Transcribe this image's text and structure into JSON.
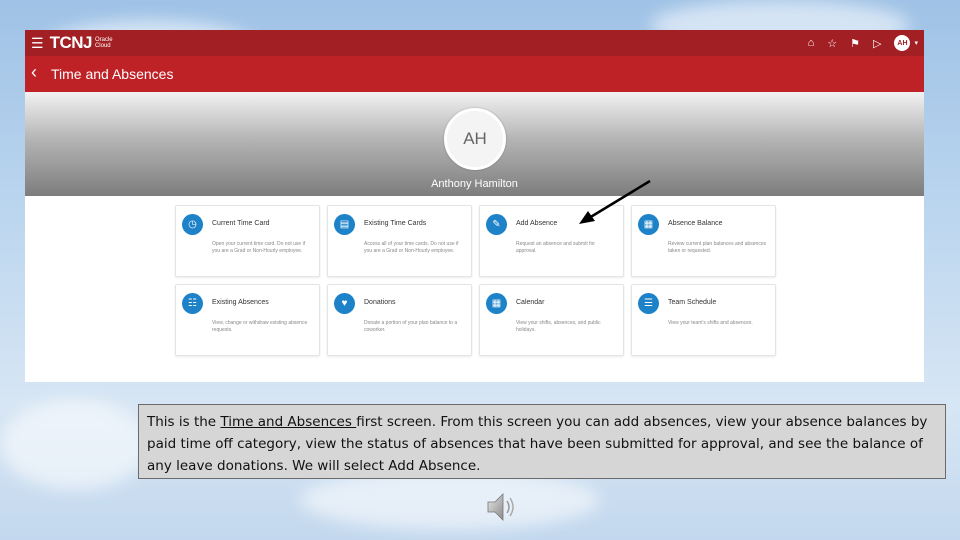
{
  "app": {
    "logo": "TCNJ",
    "logo_sub": "Oracle Cloud",
    "user_initials": "AH"
  },
  "page": {
    "title": "Time and Absences",
    "avatar_initials": "AH",
    "person_name": "Anthony Hamilton"
  },
  "tiles": [
    {
      "title": "Current Time Card",
      "desc": "Open your current time card. Do not use if you are a Grad or Non-Hourly employee.",
      "icon": "clock-icon"
    },
    {
      "title": "Existing Time Cards",
      "desc": "Access all of your time cards. Do not use if you are a Grad or Non-Hourly employee.",
      "icon": "cards-icon"
    },
    {
      "title": "Add Absence",
      "desc": "Request an absence and submit for approval.",
      "icon": "add-absence-icon"
    },
    {
      "title": "Absence Balance",
      "desc": "Review current plan balances and absences taken or requested.",
      "icon": "balance-icon"
    },
    {
      "title": "Existing Absences",
      "desc": "View, change or withdraw existing absence requests.",
      "icon": "absences-icon"
    },
    {
      "title": "Donations",
      "desc": "Donate a portion of your plan balance to a coworker.",
      "icon": "donation-icon"
    },
    {
      "title": "Calendar",
      "desc": "View your shifts, absences, and public holidays.",
      "icon": "calendar-icon"
    },
    {
      "title": "Team Schedule",
      "desc": "View your team's shifts and absences.",
      "icon": "schedule-icon"
    }
  ],
  "caption": {
    "part1": "This is the ",
    "underlined": "Time and Absences ",
    "part2": "first screen.  From this screen you can add absences, view your absence balances by paid time off category, view the status of absences that have been submitted for approval, and see the balance of any leave donations.  We will select Add Absence."
  },
  "colors": {
    "topbar": "#a21f24",
    "titlebar": "#bf2226",
    "tile_icon": "#1d82c8"
  }
}
